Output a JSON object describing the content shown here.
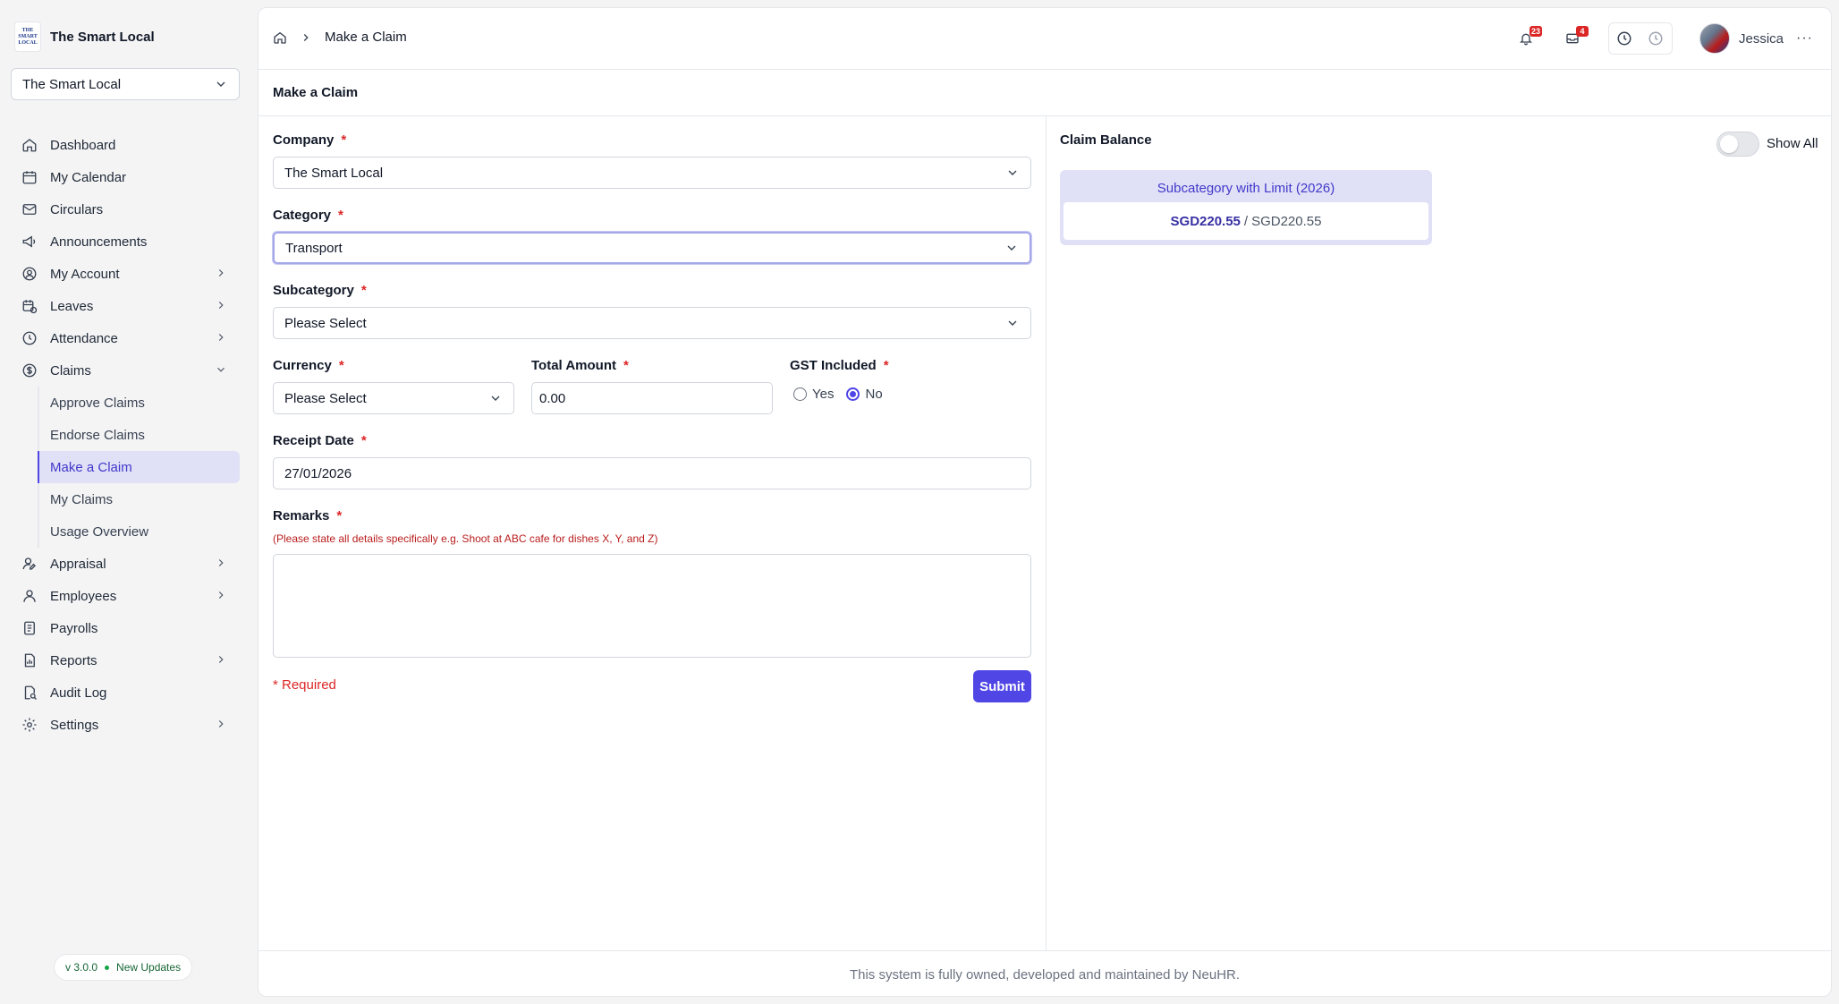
{
  "brand": {
    "logo_text": "THE SMART LOCAL",
    "name": "The Smart Local"
  },
  "company_switcher": {
    "value": "The Smart Local"
  },
  "nav": {
    "dashboard": "Dashboard",
    "calendar": "My Calendar",
    "circulars": "Circulars",
    "announcements": "Announcements",
    "account": "My Account",
    "leaves": "Leaves",
    "attendance": "Attendance",
    "claims": "Claims",
    "claims_sub": [
      "Approve Claims",
      "Endorse Claims",
      "Make a Claim",
      "My Claims",
      "Usage Overview"
    ],
    "appraisal": "Appraisal",
    "employees": "Employees",
    "payrolls": "Payrolls",
    "reports": "Reports",
    "audit_log": "Audit Log",
    "settings": "Settings"
  },
  "version": {
    "number": "v 3.0.0",
    "updates": "New Updates"
  },
  "breadcrumb": {
    "current": "Make a Claim"
  },
  "header": {
    "notifications_count": "23",
    "mail_count": "4",
    "user_name": "Jessica"
  },
  "page": {
    "title": "Make a Claim"
  },
  "form": {
    "company": {
      "label": "Company",
      "value": "The Smart Local"
    },
    "category": {
      "label": "Category",
      "value": "Transport"
    },
    "subcategory": {
      "label": "Subcategory",
      "value": "Please Select"
    },
    "currency": {
      "label": "Currency",
      "value": "Please Select"
    },
    "total_amount": {
      "label": "Total Amount",
      "value": "0.00"
    },
    "gst": {
      "label": "GST Included",
      "yes": "Yes",
      "no": "No",
      "selected": "No"
    },
    "receipt_date": {
      "label": "Receipt Date",
      "value": "27/01/2026"
    },
    "remarks": {
      "label": "Remarks",
      "hint": "(Please state all details specifically e.g. Shoot at ABC cafe for dishes X, Y, and Z)",
      "value": ""
    },
    "required_marker": "*",
    "required_note": "* Required",
    "submit": "Submit"
  },
  "claim_balance": {
    "title": "Claim Balance",
    "show_all": "Show All",
    "card_title": "Subcategory with Limit (2026)",
    "used": "SGD220.55",
    "separator": "/",
    "limit": "SGD220.55"
  },
  "footer": {
    "text": "This system is fully owned, developed and maintained by NeuHR."
  },
  "colors": {
    "accent": "#4f46e5",
    "active_bg": "#e0e1f7",
    "required": "#dc2626"
  }
}
